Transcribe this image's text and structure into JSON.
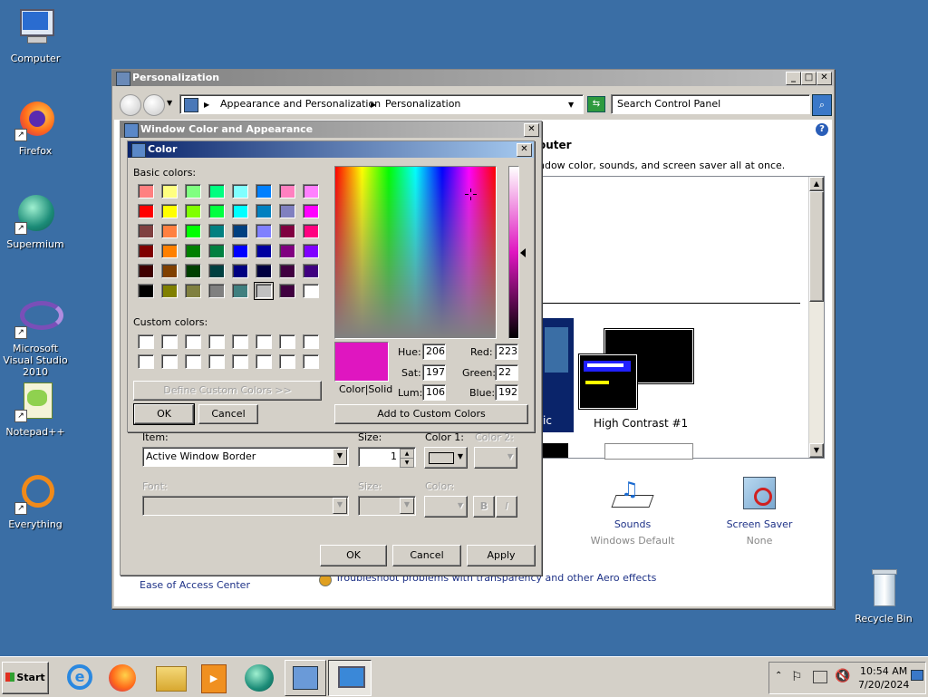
{
  "desktop": {
    "icons": [
      {
        "label": "Computer"
      },
      {
        "label": "Firefox"
      },
      {
        "label": "Supermium"
      },
      {
        "label": "Microsoft Visual Studio 2010"
      },
      {
        "label": "Notepad++"
      },
      {
        "label": "Everything"
      },
      {
        "label": "Recycle Bin"
      }
    ]
  },
  "personalization": {
    "title": "Personalization",
    "breadcrumb": [
      "Appearance and Personalization",
      "Personalization"
    ],
    "search_placeholder": "Search Control Panel",
    "heading_fragment": "outer",
    "desc_fragment": "ndow color, sounds, and screen saver all at once.",
    "theme_name": "High Contrast #1",
    "theme_fragment": "ic",
    "sounds_label": "Sounds",
    "sounds_value": "Windows Default",
    "screensaver_label": "Screen Saver",
    "screensaver_value": "None",
    "ease_link": "Ease of Access Center",
    "troubleshoot_link": "Troubleshoot problems with transparency and other Aero effects"
  },
  "wca": {
    "title": "Window Color and Appearance",
    "item_label": "Item:",
    "item_value": "Active Window Border",
    "size_label": "Size:",
    "size_value": "1",
    "color1_label": "Color 1:",
    "color2_label": "Color 2:",
    "font_label": "Font:",
    "font_size_label": "Size:",
    "font_color_label": "Color:",
    "bold_label": "B",
    "italic_label": "I",
    "ok": "OK",
    "cancel": "Cancel",
    "apply": "Apply"
  },
  "color_dialog": {
    "title": "Color",
    "basic_label": "Basic colors:",
    "custom_label": "Custom colors:",
    "define_btn": "Define Custom Colors >>",
    "ok": "OK",
    "cancel": "Cancel",
    "add_btn": "Add to Custom Colors",
    "colorsolid_label": "Color|Solid",
    "hue_label": "Hue:",
    "hue": "206",
    "sat_label": "Sat:",
    "sat": "197",
    "lum_label": "Lum:",
    "lum": "106",
    "red_label": "Red:",
    "red": "223",
    "green_label": "Green:",
    "green": "22",
    "blue_label": "Blue:",
    "blue": "192",
    "selected_color": "#df16c0",
    "basic_colors": [
      "#ff8080",
      "#ffff80",
      "#80ff80",
      "#00ff80",
      "#80ffff",
      "#0080ff",
      "#ff80c0",
      "#ff80ff",
      "#ff0000",
      "#ffff00",
      "#80ff00",
      "#00ff40",
      "#00ffff",
      "#0080c0",
      "#8080c0",
      "#ff00ff",
      "#804040",
      "#ff8040",
      "#00ff00",
      "#008080",
      "#004080",
      "#8080ff",
      "#800040",
      "#ff0080",
      "#800000",
      "#ff8000",
      "#008000",
      "#008040",
      "#0000ff",
      "#0000a0",
      "#800080",
      "#8000ff",
      "#400000",
      "#804000",
      "#004000",
      "#004040",
      "#000080",
      "#000040",
      "#400040",
      "#400080",
      "#000000",
      "#808000",
      "#808040",
      "#808080",
      "#408080",
      "#c0c0c0",
      "#400040",
      "#ffffff"
    ]
  },
  "taskbar": {
    "start": "Start",
    "time": "10:54 AM",
    "date": "7/20/2024"
  }
}
